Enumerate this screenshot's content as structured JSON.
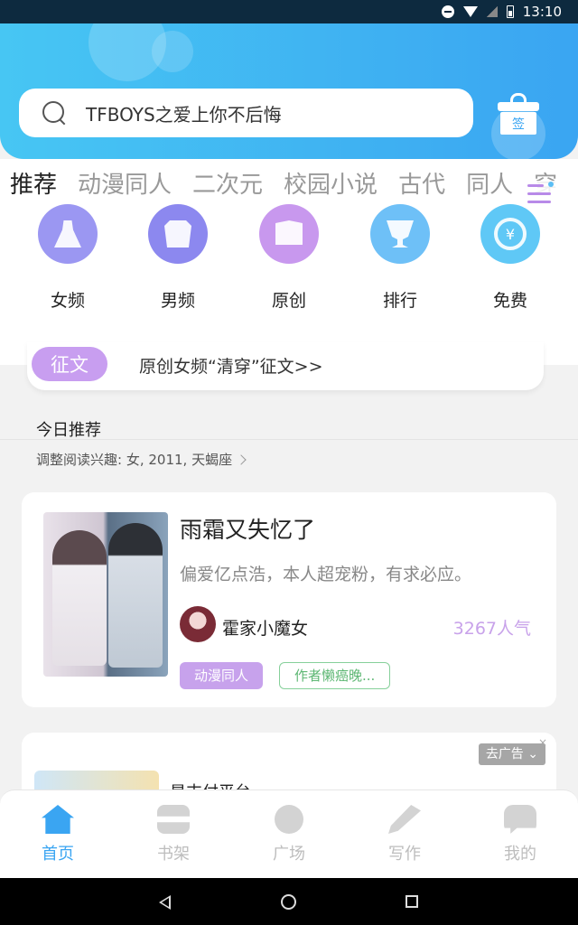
{
  "status_bar": {
    "time": "13:10"
  },
  "header": {
    "search_text": "TFBOYS之爱上你不后悔",
    "checkin_label": "签"
  },
  "tabs": [
    "推荐",
    "动漫同人",
    "二次元",
    "校园小说",
    "古代",
    "同人",
    "穿"
  ],
  "categories": [
    {
      "label": "女频",
      "icon": "dress-icon"
    },
    {
      "label": "男频",
      "icon": "shirt-icon"
    },
    {
      "label": "原创",
      "icon": "book-icon"
    },
    {
      "label": "排行",
      "icon": "trophy-icon"
    },
    {
      "label": "免费",
      "icon": "coin-icon"
    }
  ],
  "essay": {
    "badge": "征文",
    "text": "原创女频“清穿”征文>>"
  },
  "today": {
    "title": "今日推荐",
    "interest": "调整阅读兴趣: 女, 2011, 天蝎座"
  },
  "book": {
    "title": "雨霜又失忆了",
    "description": "偏爱亿点浩，本人超宠粉，有求必应。",
    "author": "霍家小魔女",
    "popularity": "3267人气",
    "tag_category": "动漫同人",
    "tag_author": "作者懒癌晚..."
  },
  "ad": {
    "button": "去广告",
    "title": "是支付平台",
    "close": "×"
  },
  "bottom_nav": [
    {
      "label": "首页",
      "icon": "home-icon",
      "active": true
    },
    {
      "label": "书架",
      "icon": "bookshelf-icon",
      "active": false
    },
    {
      "label": "广场",
      "icon": "planet-icon",
      "active": false
    },
    {
      "label": "写作",
      "icon": "pen-icon",
      "active": false
    },
    {
      "label": "我的",
      "icon": "chat-icon",
      "active": false
    }
  ],
  "colors": {
    "accent": "#3aa5f2",
    "purple": "#c89ef0"
  }
}
